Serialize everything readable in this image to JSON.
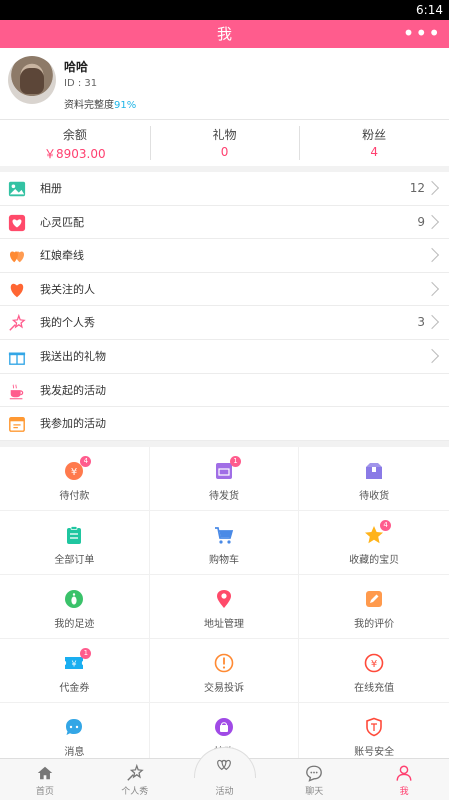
{
  "status": {
    "time": "6:14"
  },
  "header": {
    "title": "我",
    "more": "•••"
  },
  "profile": {
    "name": "哈哈",
    "id": "ID : 31",
    "completeness_label": "资料完整度",
    "completeness_value": "91%"
  },
  "stats": [
    {
      "label": "余额",
      "value": "￥8903.00"
    },
    {
      "label": "礼物",
      "value": "0"
    },
    {
      "label": "粉丝",
      "value": "4"
    }
  ],
  "menu": [
    {
      "label": "相册",
      "count": "12",
      "icon": "photo-album-icon",
      "color": "#33c2a3",
      "chevron": true
    },
    {
      "label": "心灵匹配",
      "count": "9",
      "icon": "heart-match-icon",
      "color": "#ff4a6a",
      "chevron": true
    },
    {
      "label": "红娘牵线",
      "count": "",
      "icon": "matchmaker-icon",
      "color": "#ff8a33",
      "chevron": true
    },
    {
      "label": "我关注的人",
      "count": "",
      "icon": "heart-icon",
      "color": "#ff6633",
      "chevron": true
    },
    {
      "label": "我的个人秀",
      "count": "3",
      "icon": "star-wand-icon",
      "color": "#ff5c8d",
      "chevron": true
    },
    {
      "label": "我送出的礼物",
      "count": "",
      "icon": "gift-icon",
      "color": "#33a6e6",
      "chevron": true
    },
    {
      "label": "我发起的活动",
      "count": "",
      "icon": "coffee-cup-icon",
      "color": "#ff5c8d",
      "chevron": false
    },
    {
      "label": "我参加的活动",
      "count": "",
      "icon": "calendar-icon",
      "color": "#ff9933",
      "chevron": false
    }
  ],
  "grid": [
    {
      "label": "待付款",
      "icon": "yuan-coin-icon",
      "color": "#ff7a4d",
      "badge": "4"
    },
    {
      "label": "待发货",
      "icon": "shipping-box-icon",
      "color": "#a06ee6",
      "badge": "1"
    },
    {
      "label": "待收货",
      "icon": "package-icon",
      "color": "#8a7ae6",
      "badge": ""
    },
    {
      "label": "全部订单",
      "icon": "clipboard-icon",
      "color": "#1fc6a0",
      "badge": ""
    },
    {
      "label": "购物车",
      "icon": "cart-icon",
      "color": "#4a8ae6",
      "badge": ""
    },
    {
      "label": "收藏的宝贝",
      "icon": "star-icon",
      "color": "#ffb31a",
      "badge": "4"
    },
    {
      "label": "我的足迹",
      "icon": "footprint-icon",
      "color": "#3ac26a",
      "badge": ""
    },
    {
      "label": "地址管理",
      "icon": "location-pin-icon",
      "color": "#ff4a6a",
      "badge": ""
    },
    {
      "label": "我的评价",
      "icon": "edit-icon",
      "color": "#ff9a4d",
      "badge": ""
    },
    {
      "label": "代金券",
      "icon": "coupon-icon",
      "color": "#1aaef0",
      "badge": "1"
    },
    {
      "label": "交易投诉",
      "icon": "alert-circle-icon",
      "color": "#ff8a33",
      "badge": ""
    },
    {
      "label": "在线充值",
      "icon": "yuan-circle-icon",
      "color": "#ff4a3a",
      "badge": ""
    },
    {
      "label": "消息",
      "icon": "chat-face-icon",
      "color": "#33a6e6",
      "badge": ""
    },
    {
      "label": "抢购",
      "icon": "shopping-bag-icon",
      "color": "#a04ae6",
      "badge": ""
    },
    {
      "label": "账号安全",
      "icon": "shield-icon",
      "color": "#ff4a3a",
      "badge": ""
    }
  ],
  "tabs": [
    {
      "label": "首页",
      "icon": "home-icon",
      "active": false
    },
    {
      "label": "个人秀",
      "icon": "star-wand-icon",
      "active": false
    },
    {
      "label": "活动",
      "icon": "hearts-icon",
      "active": false
    },
    {
      "label": "聊天",
      "icon": "chat-bubble-icon",
      "active": false
    },
    {
      "label": "我",
      "icon": "person-icon",
      "active": true
    }
  ]
}
